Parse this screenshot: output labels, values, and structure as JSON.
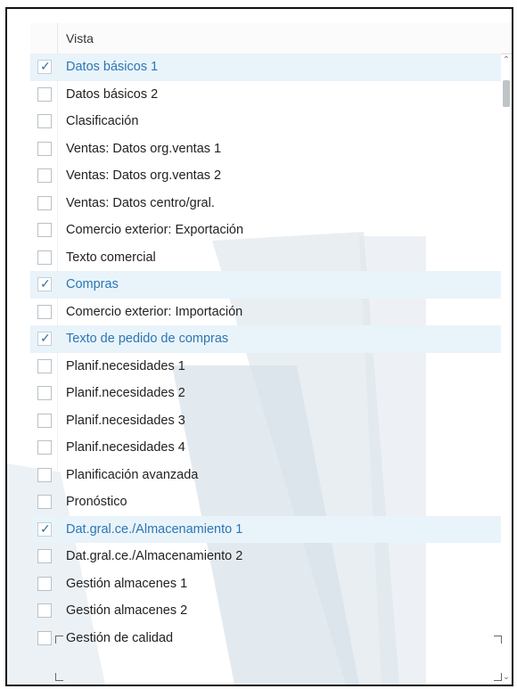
{
  "header": {
    "column_title": "Vista"
  },
  "rows": [
    {
      "label": "Datos básicos 1",
      "checked": true
    },
    {
      "label": "Datos básicos 2",
      "checked": false
    },
    {
      "label": "Clasificación",
      "checked": false
    },
    {
      "label": "Ventas: Datos org.ventas 1",
      "checked": false
    },
    {
      "label": "Ventas: Datos org.ventas 2",
      "checked": false
    },
    {
      "label": "Ventas: Datos centro/gral.",
      "checked": false
    },
    {
      "label": "Comercio exterior: Exportación",
      "checked": false
    },
    {
      "label": "Texto comercial",
      "checked": false
    },
    {
      "label": "Compras",
      "checked": true
    },
    {
      "label": "Comercio exterior: Importación",
      "checked": false
    },
    {
      "label": "Texto de pedido de compras",
      "checked": true
    },
    {
      "label": "Planif.necesidades 1",
      "checked": false
    },
    {
      "label": "Planif.necesidades 2",
      "checked": false
    },
    {
      "label": "Planif.necesidades 3",
      "checked": false
    },
    {
      "label": "Planif.necesidades 4",
      "checked": false
    },
    {
      "label": "Planificación avanzada",
      "checked": false
    },
    {
      "label": "Pronóstico",
      "checked": false
    },
    {
      "label": "Dat.gral.ce./Almacenamiento 1",
      "checked": true
    },
    {
      "label": "Dat.gral.ce./Almacenamiento 2",
      "checked": false
    },
    {
      "label": "Gestión almacenes 1",
      "checked": false
    },
    {
      "label": "Gestión almacenes 2",
      "checked": false
    },
    {
      "label": "Gestión de calidad",
      "checked": false
    }
  ],
  "icons": {
    "check": "checkmark-icon",
    "scroll_up": "chevron-up-icon",
    "scroll_down": "chevron-down-icon"
  },
  "colors": {
    "selected_text": "#2b77b3",
    "selected_bg": "#e9f3fa",
    "watermark": "#d3dee7"
  }
}
